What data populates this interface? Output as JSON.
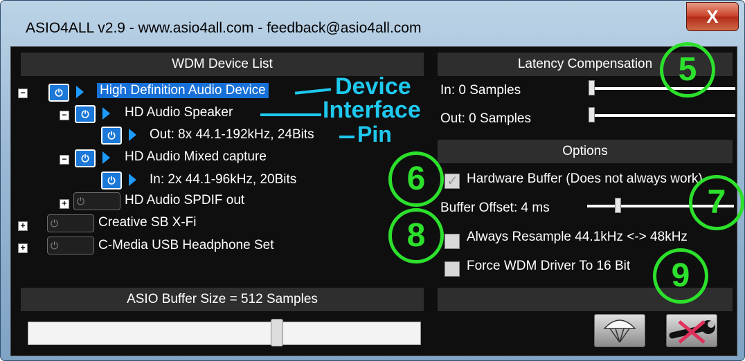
{
  "window": {
    "title": "ASIO4ALL v2.9 - www.asio4all.com - feedback@asio4all.com",
    "close_label": "X"
  },
  "wdm": {
    "header": "WDM Device List",
    "tree": {
      "device_name": "High Definition Audio Device",
      "speaker": "HD Audio Speaker",
      "out_pin": "Out: 8x 44.1-192kHz, 24Bits",
      "capture": "HD Audio Mixed capture",
      "in_pin": "In:  2x 44.1-96kHz, 20Bits",
      "spdif": "HD Audio SPDIF out",
      "creative": "Creative SB X-Fi",
      "cmedia": "C-Media USB Headphone Set"
    },
    "annotations": {
      "device": "Device",
      "interface": "Interface",
      "pin": "Pin"
    },
    "expander_minus": "−",
    "expander_plus": "+",
    "power_glyph": "⏻"
  },
  "latency": {
    "header": "Latency Compensation",
    "in_label": "In:  0 Samples",
    "out_label": "Out: 0 Samples"
  },
  "options": {
    "header": "Options",
    "hardware_buffer": "Hardware Buffer (Does not always work)",
    "buffer_offset": "Buffer Offset: 4 ms",
    "always_resample": "Always Resample 44.1kHz <-> 48kHz",
    "force_wdm": "Force WDM Driver To 16 Bit"
  },
  "asio": {
    "header": "ASIO Buffer Size = 512 Samples",
    "slider_fraction": 0.62
  },
  "callouts": {
    "c5": "5",
    "c6": "6",
    "c7": "7",
    "c8": "8",
    "c9": "9"
  },
  "colors": {
    "accent_cyan": "#1ec8ee",
    "callout_green": "#2ce02c",
    "selection_blue": "#1670d8"
  }
}
